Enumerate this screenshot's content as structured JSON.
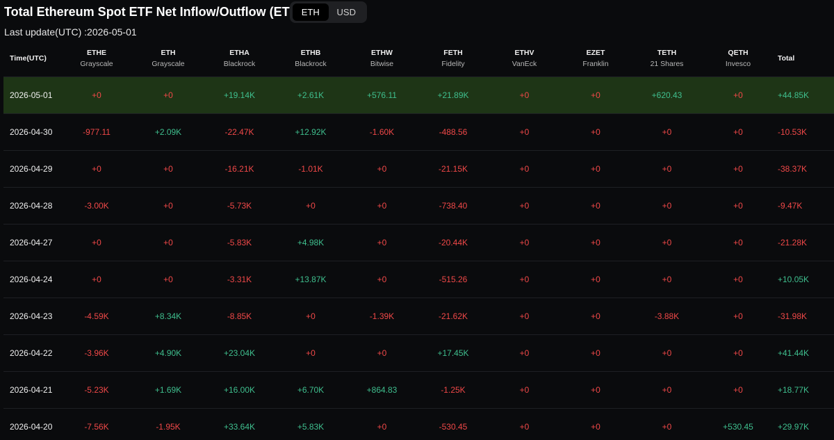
{
  "header": {
    "title": "Total Ethereum Spot ETF Net Inflow/Outflow (ETH)",
    "toggle": [
      {
        "label": "ETH",
        "active": true
      },
      {
        "label": "USD",
        "active": false
      }
    ],
    "last_update": "Last update(UTC) :2026-05-01"
  },
  "table": {
    "columns": [
      {
        "code": "Time(UTC)",
        "issuer": ""
      },
      {
        "code": "ETHE",
        "issuer": "Grayscale"
      },
      {
        "code": "ETH",
        "issuer": "Grayscale"
      },
      {
        "code": "ETHA",
        "issuer": "Blackrock"
      },
      {
        "code": "ETHB",
        "issuer": "Blackrock"
      },
      {
        "code": "ETHW",
        "issuer": "Bitwise"
      },
      {
        "code": "FETH",
        "issuer": "Fidelity"
      },
      {
        "code": "ETHV",
        "issuer": "VanEck"
      },
      {
        "code": "EZET",
        "issuer": "Franklin"
      },
      {
        "code": "TETH",
        "issuer": "21 Shares"
      },
      {
        "code": "QETH",
        "issuer": "Invesco"
      },
      {
        "code": "Total",
        "issuer": ""
      }
    ],
    "rows": [
      [
        "2026-05-01",
        "+0",
        "+0",
        "+19.14K",
        "+2.61K",
        "+576.11",
        "+21.89K",
        "+0",
        "+0",
        "+620.43",
        "+0",
        "+44.85K"
      ],
      [
        "2026-04-30",
        "-977.11",
        "+2.09K",
        "-22.47K",
        "+12.92K",
        "-1.60K",
        "-488.56",
        "+0",
        "+0",
        "+0",
        "+0",
        "-10.53K"
      ],
      [
        "2026-04-29",
        "+0",
        "+0",
        "-16.21K",
        "-1.01K",
        "+0",
        "-21.15K",
        "+0",
        "+0",
        "+0",
        "+0",
        "-38.37K"
      ],
      [
        "2026-04-28",
        "-3.00K",
        "+0",
        "-5.73K",
        "+0",
        "+0",
        "-738.40",
        "+0",
        "+0",
        "+0",
        "+0",
        "-9.47K"
      ],
      [
        "2026-04-27",
        "+0",
        "+0",
        "-5.83K",
        "+4.98K",
        "+0",
        "-20.44K",
        "+0",
        "+0",
        "+0",
        "+0",
        "-21.28K"
      ],
      [
        "2026-04-24",
        "+0",
        "+0",
        "-3.31K",
        "+13.87K",
        "+0",
        "-515.26",
        "+0",
        "+0",
        "+0",
        "+0",
        "+10.05K"
      ],
      [
        "2026-04-23",
        "-4.59K",
        "+8.34K",
        "-8.85K",
        "+0",
        "-1.39K",
        "-21.62K",
        "+0",
        "+0",
        "-3.88K",
        "+0",
        "-31.98K"
      ],
      [
        "2026-04-22",
        "-3.96K",
        "+4.90K",
        "+23.04K",
        "+0",
        "+0",
        "+17.45K",
        "+0",
        "+0",
        "+0",
        "+0",
        "+41.44K"
      ],
      [
        "2026-04-21",
        "-5.23K",
        "+1.69K",
        "+16.00K",
        "+6.70K",
        "+864.83",
        "-1.25K",
        "+0",
        "+0",
        "+0",
        "+0",
        "+18.77K"
      ],
      [
        "2026-04-20",
        "-7.56K",
        "-1.95K",
        "+33.64K",
        "+5.83K",
        "+0",
        "-530.45",
        "+0",
        "+0",
        "+0",
        "+530.45",
        "+29.97K"
      ]
    ],
    "highlight_row": 0,
    "colors": {
      "positive": "#3fbf8e",
      "negative": "#f04848",
      "zero": "#f04848",
      "highlight_bg": "#1e3516"
    }
  }
}
